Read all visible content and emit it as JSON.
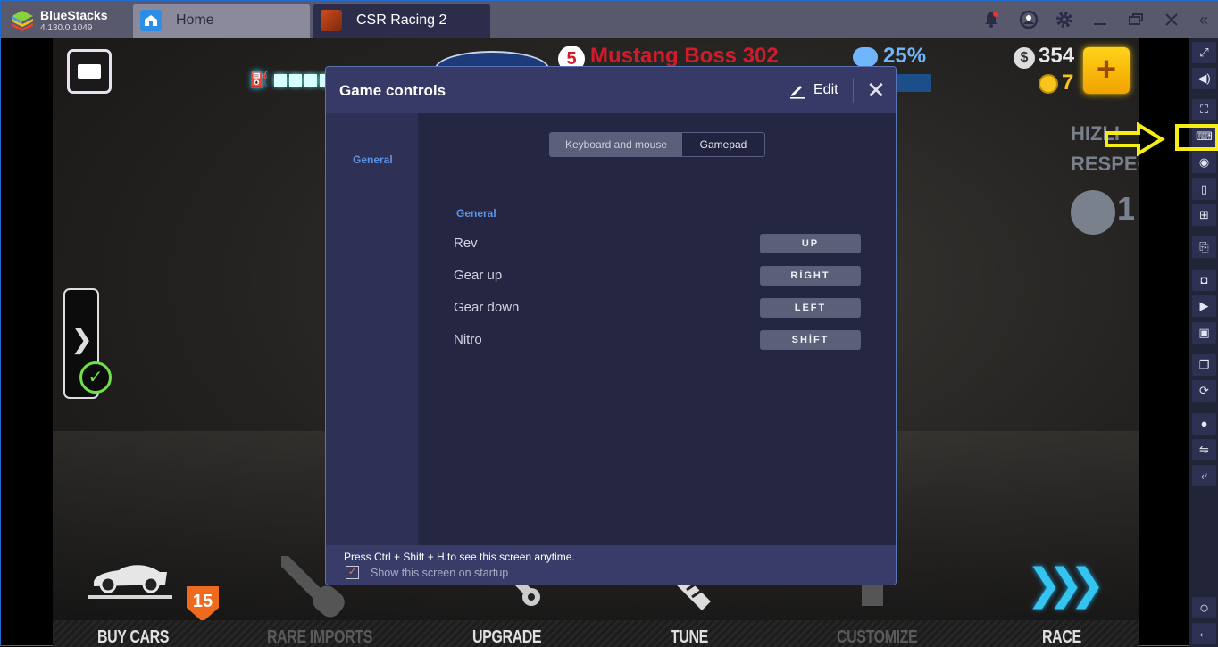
{
  "app": {
    "name": "BlueStacks",
    "version": "4.130.0.1049"
  },
  "tabs": [
    {
      "label": "Home",
      "icon": "home-icon",
      "active": false
    },
    {
      "label": "CSR Racing 2",
      "icon": "csr2-game-icon",
      "active": true
    }
  ],
  "titlebar_icons": [
    "bell-icon",
    "account-icon",
    "gear-icon",
    "minimize-icon",
    "restore-icon",
    "close-icon",
    "collapse-sidebar-icon"
  ],
  "colors": {
    "titlebar": "#59596d",
    "dialog_bg": "#252742",
    "dialog_header": "#373a66",
    "accent_blue": "#5b93e6",
    "highlight_yellow": "#f6ec16",
    "notification_dot": "#e8382c"
  },
  "game_hud": {
    "car_name": "Mustang Boss 302",
    "car_badge": "5",
    "respect_percent": "25%",
    "cash": "354",
    "gold": "7",
    "add_currency": "+",
    "fuel_segments_visible": 5,
    "respect_panel_lines": [
      "HIZLI",
      "RESPEC"
    ],
    "respect_level": "1",
    "buy_cars_badge": "15",
    "nav": [
      {
        "label": "BUY CARS",
        "enabled": true
      },
      {
        "label": "RARE IMPORTS",
        "enabled": false
      },
      {
        "label": "UPGRADE",
        "enabled": true
      },
      {
        "label": "TUNE",
        "enabled": true
      },
      {
        "label": "CUSTOMIZE",
        "enabled": false
      },
      {
        "label": "RACE",
        "enabled": true
      }
    ]
  },
  "dialog": {
    "title": "Game controls",
    "edit_label": "Edit",
    "close_glyph": "✕",
    "sidebar_items": [
      "General"
    ],
    "mode_toggle": {
      "options": [
        "Keyboard and mouse",
        "Gamepad"
      ],
      "selected": "Keyboard and mouse"
    },
    "section_title": "General",
    "controls": [
      {
        "name": "Rev",
        "key": "UP"
      },
      {
        "name": "Gear up",
        "key": "RİGHT"
      },
      {
        "name": "Gear down",
        "key": "LEFT"
      },
      {
        "name": "Nitro",
        "key": "SHİFT"
      }
    ],
    "footer_hint": "Press Ctrl + Shift + H to see this screen anytime.",
    "startup_checkbox": {
      "label": "Show this screen on startup",
      "checked": true
    }
  },
  "right_sidebar": [
    {
      "name": "fullscreen-icon",
      "glyph": "⤢"
    },
    {
      "name": "volume-icon",
      "glyph": "🔊"
    },
    {
      "name": "screen-capture-icon",
      "glyph": "⛶"
    },
    {
      "name": "keyboard-icon",
      "glyph": "⌨",
      "highlighted": true
    },
    {
      "name": "eye-icon",
      "glyph": "◉"
    },
    {
      "name": "phone-rotate-icon",
      "glyph": "▯"
    },
    {
      "name": "gamepad-icon",
      "glyph": "🎮"
    },
    {
      "name": "apk-install-icon",
      "glyph": "⎘"
    },
    {
      "name": "screenshot-camera-icon",
      "glyph": "📷"
    },
    {
      "name": "video-record-icon",
      "glyph": "▶"
    },
    {
      "name": "media-folder-icon",
      "glyph": "🖼"
    },
    {
      "name": "multi-instance-icon",
      "glyph": "❐"
    },
    {
      "name": "sync-icon",
      "glyph": "⟳"
    },
    {
      "name": "location-icon",
      "glyph": "⚲"
    },
    {
      "name": "shake-icon",
      "glyph": "⇋"
    },
    {
      "name": "rotate-icon",
      "glyph": "⤶"
    },
    {
      "name": "home-circle-icon",
      "glyph": "○"
    },
    {
      "name": "back-arrow-icon",
      "glyph": "←"
    }
  ]
}
